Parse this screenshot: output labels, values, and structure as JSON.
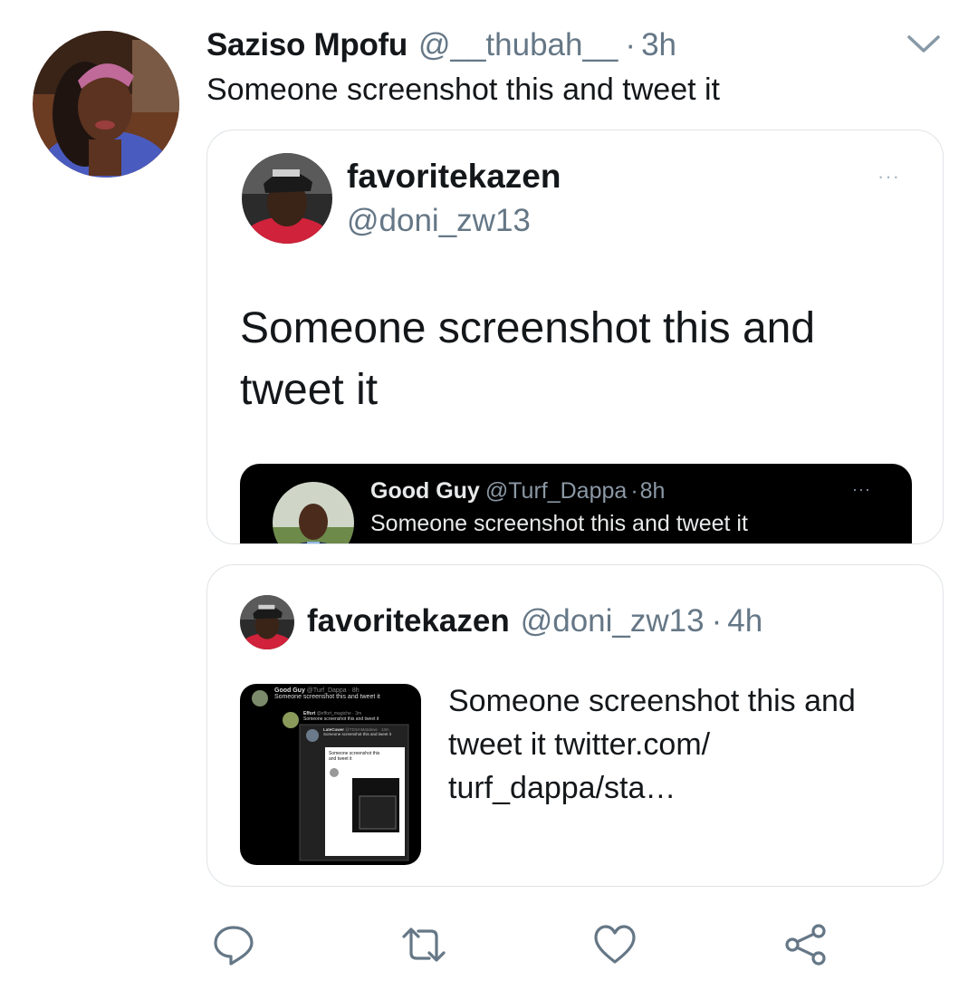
{
  "tweet": {
    "author_name": "Saziso Mpofu",
    "author_handle": "@__thubah__",
    "separator": "·",
    "time": "3h",
    "text": "Someone screenshot this and tweet it",
    "avatar_icon": "profile-photo",
    "menu_icon": "chevron-down-icon"
  },
  "quote_card": {
    "name": "favoritekazen",
    "handle": "@doni_zw13",
    "more": "···",
    "text": "Someone screenshot this and tweet it",
    "embedded": {
      "name": "Good Guy",
      "handle": "@Turf_Dappa",
      "separator": "·",
      "time": "8h",
      "text": "Someone screenshot this and tweet it",
      "more": "···"
    }
  },
  "link_card": {
    "name": "favoritekazen",
    "handle": "@doni_zw13",
    "separator": "·",
    "time": "4h",
    "text": "Someone screenshot this and tweet it twitter.com/ turf_dappa/sta…",
    "thumb": {
      "row1_name": "Good Guy",
      "row1_meta": "@Turf_Dappa · 8h",
      "row1_text": "Someone screenshot this and tweet it",
      "row2_name": "Effort",
      "row2_meta": "@effort_magiche · 3m",
      "row2_text": "Someone screenshot this and tweet it",
      "row3_name": "LateCuwer",
      "row3_meta": "@TDSmMatabwe · 13m",
      "row3_text": "Someone screenshot this and tweet it",
      "inner_text": "Someone screenshot this and tweet it"
    }
  },
  "actions": {
    "reply": "reply-icon",
    "retweet": "retweet-icon",
    "like": "heart-icon",
    "share": "share-icon"
  },
  "colors": {
    "text": "#14171a",
    "secondary": "#657786",
    "border": "#dfe3e7",
    "dark_bg": "#000000"
  }
}
